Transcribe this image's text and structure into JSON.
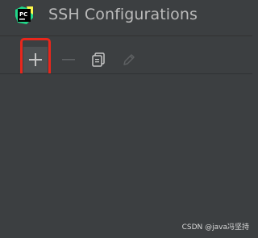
{
  "window": {
    "title": "SSH Configurations",
    "app_logo_text": "PC"
  },
  "toolbar": {
    "add_icon": "plus-icon",
    "remove_icon": "minus-icon",
    "copy_icon": "copy-icon",
    "edit_icon": "pencil-icon"
  },
  "watermark": {
    "text": "CSDN @java冯坚持"
  },
  "colors": {
    "background": "#3c3f41",
    "text": "#bbbbbb",
    "highlight": "#e8271c",
    "logo_green": "#21d789",
    "logo_yellow": "#fcf84a"
  }
}
